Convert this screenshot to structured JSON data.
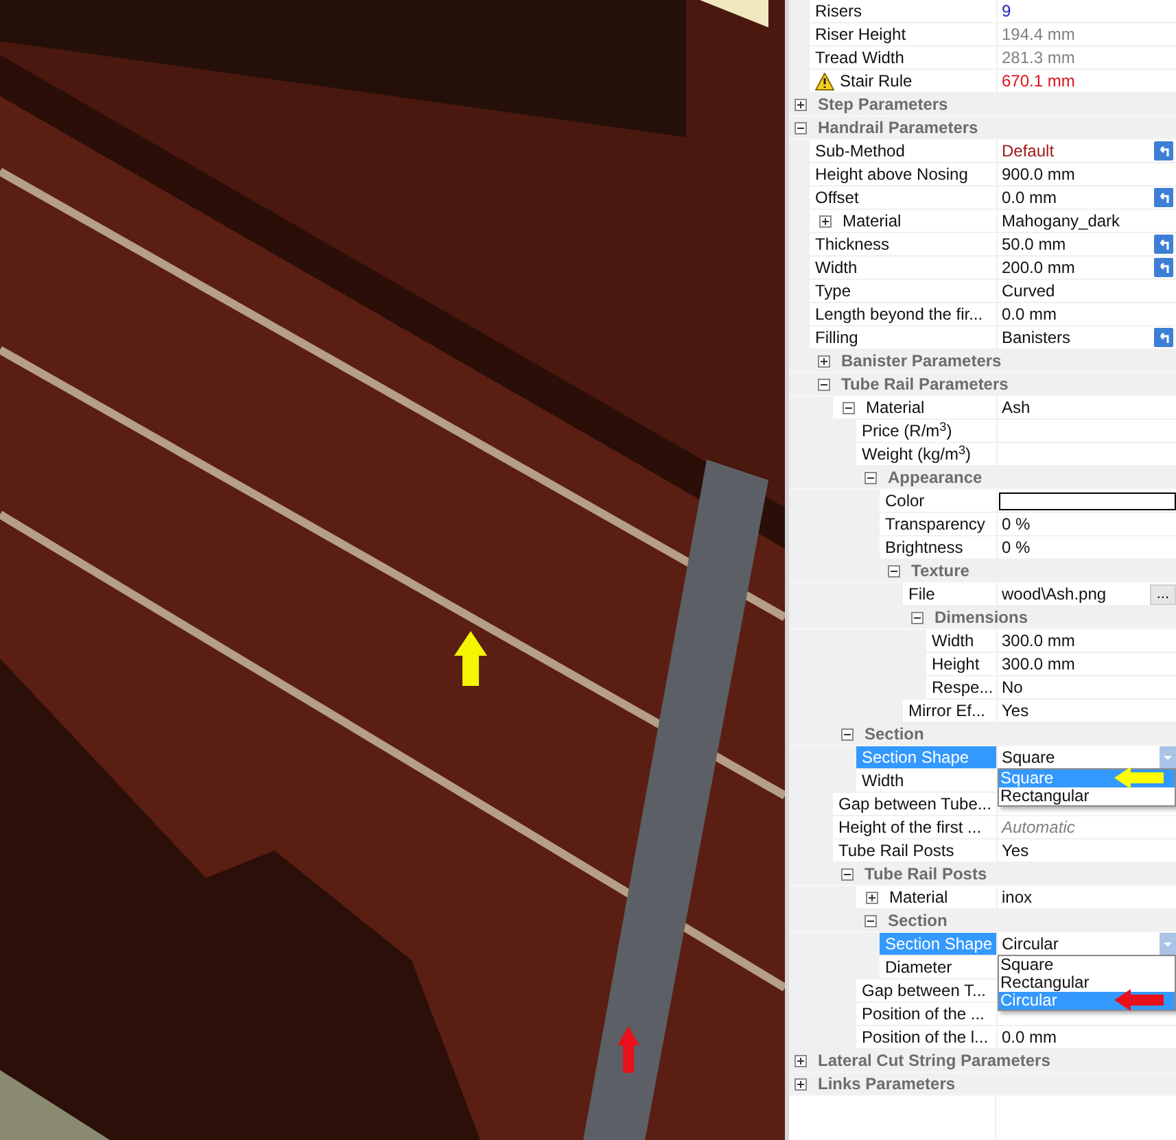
{
  "property_grid": {
    "partial_rows": [
      {
        "kind": "property",
        "label": "Risers",
        "value": {
          "text": "9",
          "kind": "link"
        }
      },
      {
        "kind": "property",
        "label": "Riser Height",
        "value": {
          "text": "194.4 mm",
          "kind": "readonly"
        }
      },
      {
        "kind": "property",
        "label": "Tread Width",
        "value": {
          "text": "281.3 mm",
          "kind": "readonly"
        }
      },
      {
        "kind": "property",
        "label": "Stair Rule",
        "value": {
          "text": "670.1 mm",
          "kind": "error"
        },
        "warning": true
      }
    ],
    "groups": [
      {
        "kind": "group",
        "label": "Step Parameters",
        "expanded": false
      },
      {
        "kind": "group",
        "label": "Handrail Parameters",
        "expanded": true,
        "children": [
          {
            "kind": "property",
            "label": "Sub-Method",
            "value": {
              "text": "Default",
              "kind": "modified"
            },
            "reset_button": true
          },
          {
            "kind": "property",
            "label": "Height above Nosing",
            "value": "900.0 mm"
          },
          {
            "kind": "property",
            "label": "Offset",
            "value": "0.0 mm",
            "reset_button": true
          },
          {
            "kind": "property",
            "label": "Material",
            "value": "Mahogany_dark",
            "expanded": false
          },
          {
            "kind": "property",
            "label": "Thickness",
            "value": "50.0 mm",
            "reset_button": true
          },
          {
            "kind": "property",
            "label": "Width",
            "value": "200.0 mm",
            "reset_button": true
          },
          {
            "kind": "property",
            "label": "Type",
            "value": "Curved"
          },
          {
            "kind": "property",
            "label": "Length beyond the fir...",
            "value": "0.0 mm"
          },
          {
            "kind": "property",
            "label": "Filling",
            "value": "Banisters",
            "reset_button": true
          },
          {
            "kind": "group",
            "label": "Banister Parameters",
            "expanded": false
          },
          {
            "kind": "group",
            "label": "Tube Rail Parameters",
            "expanded": true,
            "children": [
              {
                "kind": "property",
                "label": "Material",
                "value": "Ash",
                "expanded": true,
                "children": [
                  {
                    "kind": "property",
                    "label": "Price (R/m$^{3}$)"
                  },
                  {
                    "kind": "property",
                    "label": "Weight (kg/m$^{3}$)"
                  },
                  {
                    "kind": "group",
                    "label": "Appearance",
                    "expanded": true,
                    "children": [
                      {
                        "kind": "property",
                        "label": "Color",
                        "color": "#ffffff"
                      },
                      {
                        "kind": "property",
                        "label": "Transparency",
                        "value": "0 %"
                      },
                      {
                        "kind": "property",
                        "label": "Brightness",
                        "value": "0 %"
                      },
                      {
                        "kind": "group",
                        "label": "Texture",
                        "expanded": true,
                        "children": [
                          {
                            "kind": "property",
                            "label": "File",
                            "value": "wood\\Ash.png",
                            "browse_label": "..."
                          },
                          {
                            "kind": "group",
                            "label": "Dimensions",
                            "expanded": true,
                            "children": [
                              {
                                "kind": "property",
                                "label": "Width",
                                "value": "300.0 mm"
                              },
                              {
                                "kind": "property",
                                "label": "Height",
                                "value": "300.0 mm"
                              },
                              {
                                "kind": "property",
                                "label": "Respe...",
                                "value": "No"
                              }
                            ]
                          },
                          {
                            "kind": "property",
                            "label": "Mirror Ef...",
                            "value": "Yes"
                          }
                        ]
                      }
                    ]
                  }
                ]
              },
              {
                "kind": "group",
                "label": "Section",
                "expanded": true,
                "children": [
                  {
                    "kind": "property",
                    "label": "Section Shape",
                    "value": "Square",
                    "selected": true,
                    "dropdown": [
                      {
                        "label": "Square",
                        "selected": true,
                        "color": "#ffff00"
                      },
                      {
                        "label": "Rectangular",
                        "selected": false
                      }
                    ]
                  },
                  {
                    "kind": "property",
                    "label": "Width",
                    "selected": false
                  }
                ]
              },
              {
                "kind": "property",
                "label": "Gap between Tube..."
              },
              {
                "kind": "property",
                "label": "Height of the first ...",
                "value": {
                  "text": "Automatic",
                  "kind": "auto"
                }
              },
              {
                "kind": "property",
                "label": "Tube Rail Posts",
                "value": "Yes"
              },
              {
                "kind": "group",
                "label": "Tube Rail Posts",
                "expanded": true,
                "children": [
                  {
                    "kind": "property",
                    "label": "Material",
                    "value": "inox",
                    "expanded": false
                  },
                  {
                    "kind": "group",
                    "label": "Section",
                    "expanded": true,
                    "children": [
                      {
                        "kind": "property",
                        "label": "Section Shape",
                        "value": "Circular",
                        "selected": true,
                        "dropdown": [
                          {
                            "label": "Square",
                            "selected": false
                          },
                          {
                            "label": "Rectangular",
                            "selected": false
                          },
                          {
                            "label": "Circular",
                            "selected": true,
                            "color": "#e8101a"
                          }
                        ]
                      },
                      {
                        "kind": "property",
                        "label": "Diameter",
                        "selected": false
                      }
                    ]
                  },
                  {
                    "kind": "property",
                    "label": "Gap between T..."
                  },
                  {
                    "kind": "property",
                    "label": "Position of the ..."
                  },
                  {
                    "kind": "property",
                    "label": "Position of the l...",
                    "value": "0.0 mm"
                  }
                ]
              }
            ]
          }
        ]
      },
      {
        "kind": "group",
        "label": "Lateral Cut String Parameters",
        "expanded": false
      },
      {
        "kind": "group",
        "label": "Links Parameters",
        "expanded": false
      }
    ]
  }
}
